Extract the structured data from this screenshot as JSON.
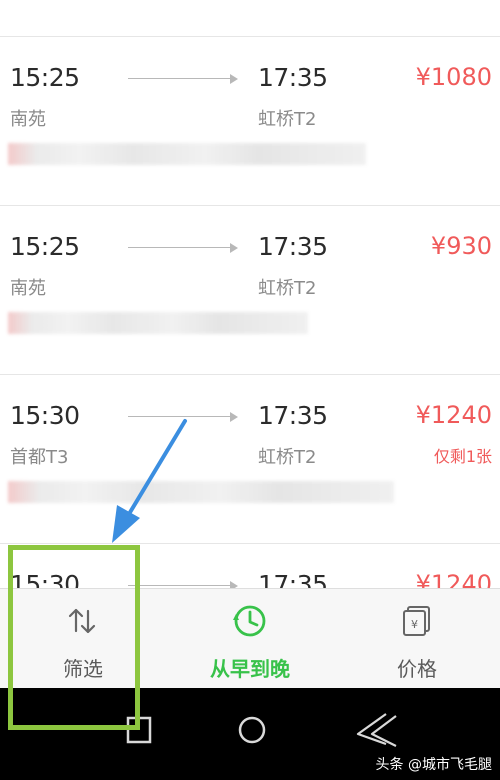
{
  "flights": [
    {
      "depart_time": "15:25",
      "arrive_time": "17:35",
      "depart_airport": "南苑",
      "arrive_airport": "虹桥T2",
      "price": "¥1080",
      "remaining": ""
    },
    {
      "depart_time": "15:25",
      "arrive_time": "17:35",
      "depart_airport": "南苑",
      "arrive_airport": "虹桥T2",
      "price": "¥930",
      "remaining": ""
    },
    {
      "depart_time": "15:30",
      "arrive_time": "17:35",
      "depart_airport": "首都T3",
      "arrive_airport": "虹桥T2",
      "price": "¥1240",
      "remaining": "仅剩1张"
    },
    {
      "depart_time": "15:30",
      "arrive_time": "17:35",
      "depart_airport": "",
      "arrive_airport": "",
      "price": "¥1240",
      "remaining": ""
    }
  ],
  "tabbar": {
    "filter_label": "筛选",
    "sort_time_label": "从早到晚",
    "price_label": "价格",
    "filter_icon": "sort-arrows-icon",
    "sort_time_icon": "clock-icon",
    "price_icon": "yen-cards-icon",
    "active_color": "#38c24a"
  },
  "navigation_bar": {
    "square_icon": "recent-apps-icon",
    "circle_icon": "home-icon",
    "back_icon": "back-icon"
  },
  "watermark": "头条 @城市飞毛腿",
  "colors": {
    "price": "#f05a5a",
    "highlight": "#8dc63f",
    "pointer": "#3b8ee0"
  }
}
